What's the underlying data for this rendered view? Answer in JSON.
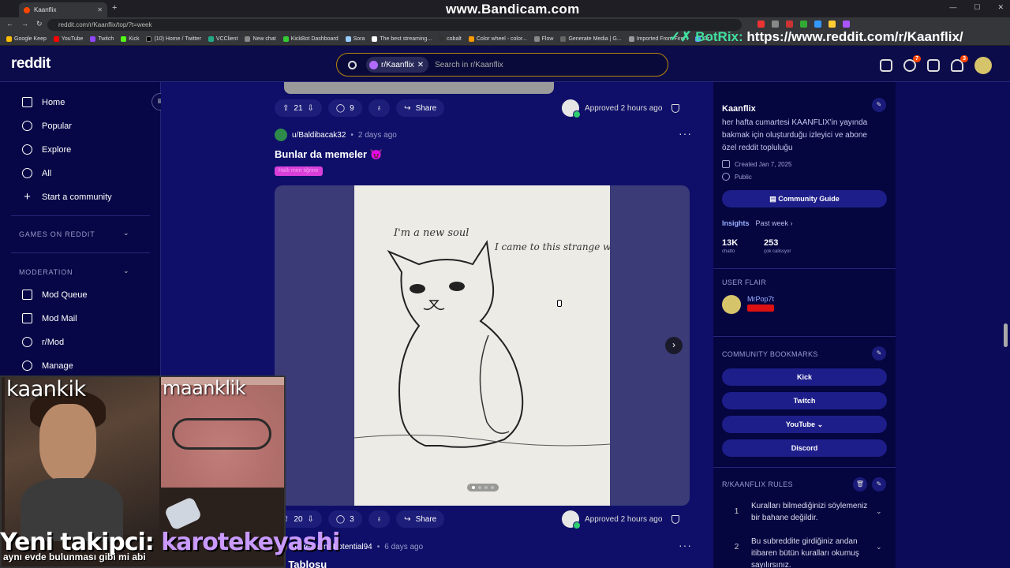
{
  "browser": {
    "tab_title": "Kaanflix",
    "url": "reddit.com/r/Kaanflix/top/?t=week",
    "watermark": "www.Bandicam.com",
    "bookmarks": [
      "Google Keep",
      "YouTube",
      "Twitch",
      "Kick",
      "(10) Home / Twitter",
      "VCClient",
      "New chat",
      "KickBot Dashboard",
      "Sora",
      "The best streaming...",
      "cobalt",
      "Color wheel - color...",
      "Flow",
      "Generate Media | G...",
      "Imported From Fire...",
      "Gr..."
    ],
    "botrix_prefix": "BotRix:",
    "botrix_link": "https://www.reddit.com/r/Kaanflix/"
  },
  "header": {
    "logo": "reddit",
    "search_chip": "r/Kaanflix",
    "search_placeholder": "Search in r/Kaanflix",
    "chat_badge": "7",
    "notif_badge": "3"
  },
  "leftnav": {
    "items": [
      "Home",
      "Popular",
      "Explore",
      "All",
      "Start a community"
    ],
    "games_section": "GAMES ON REDDIT",
    "moderation_section": "MODERATION",
    "mod_items": [
      "Mod Queue",
      "Mod Mail",
      "r/Mod",
      "Manage"
    ]
  },
  "feed": {
    "post1_actions": {
      "votes": "21",
      "comments": "9",
      "share": "Share",
      "approved": "Approved 2 hours ago"
    },
    "post2": {
      "author": "u/Baldibacak32",
      "time": "2 days ago",
      "title": "Bunlar da memeler 😈",
      "flair": "Hallı meri tiğrine",
      "drawing_text_left": "I'm a new soul",
      "drawing_text_right": "I came to this strange world",
      "votes": "20",
      "comments": "3",
      "share": "Share",
      "approved": "Approved 2 hours ago"
    },
    "post3": {
      "author": "u/Frequent-Potential94",
      "time": "6 days ago",
      "title": "At Tablosu"
    }
  },
  "rightbar": {
    "name": "Kaanflix",
    "description": "her hafta cumartesi KAANFLIX'in yayında bakmak için oluşturduğu izleyici ve abone özel reddit topluluğu",
    "created": "Created Jan 7, 2025",
    "visibility": "Public",
    "guide_button": "Community Guide",
    "insights": "Insights",
    "insights_period": "Past week ›",
    "stat1_value": "13K",
    "stat1_label": "chatto",
    "stat2_value": "253",
    "stat2_label": "çok calissyor",
    "user_flair_head": "USER FLAIR",
    "flair_user": "MrPop7t",
    "bookmarks_head": "COMMUNITY BOOKMARKS",
    "bookmarks": [
      "Kick",
      "Twitch",
      "YouTube",
      "Discord"
    ],
    "rules_head": "R/KAANFLIX RULES",
    "rules": [
      {
        "num": "1",
        "text": "Kuralları bilmediğinizi söylemeniz bir bahane değildir."
      },
      {
        "num": "2",
        "text": "Bu subreddite girdiğiniz andan itibaren bütün kuralları okumuş sayılırsınız."
      }
    ]
  },
  "overlay": {
    "cam1_label": "kaankik",
    "cam2_label": "maanklik",
    "follower_prefix": "Yeni takipci:",
    "follower_name": "karotekeyashi",
    "subtitle": "aynı evde bulunması gibi mi abi"
  }
}
